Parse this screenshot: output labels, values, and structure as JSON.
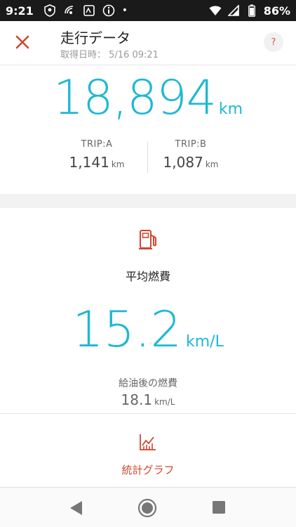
{
  "status_bar": {
    "time": "9:21",
    "dot": "•",
    "battery_percent": "86%"
  },
  "header": {
    "title": "走行データ",
    "subtitle": "取得日時： 5/16 09:21",
    "help_label": "?"
  },
  "odometer": {
    "value": "18,894",
    "unit": "km"
  },
  "trips": [
    {
      "label": "TRIP:A",
      "value": "1,141",
      "unit": "km"
    },
    {
      "label": "TRIP:B",
      "value": "1,087",
      "unit": "km"
    }
  ],
  "fuel": {
    "label": "平均燃費",
    "value": "15.2",
    "unit": "km/L",
    "after_refuel_label": "給油後の燃費",
    "after_refuel_value": "18.1",
    "after_refuel_unit": "km/L"
  },
  "graph": {
    "label": "統計グラフ"
  },
  "colors": {
    "accent": "#1fb8d3",
    "icon_red": "#d2462d",
    "status_bar": "#1a1a1a"
  }
}
